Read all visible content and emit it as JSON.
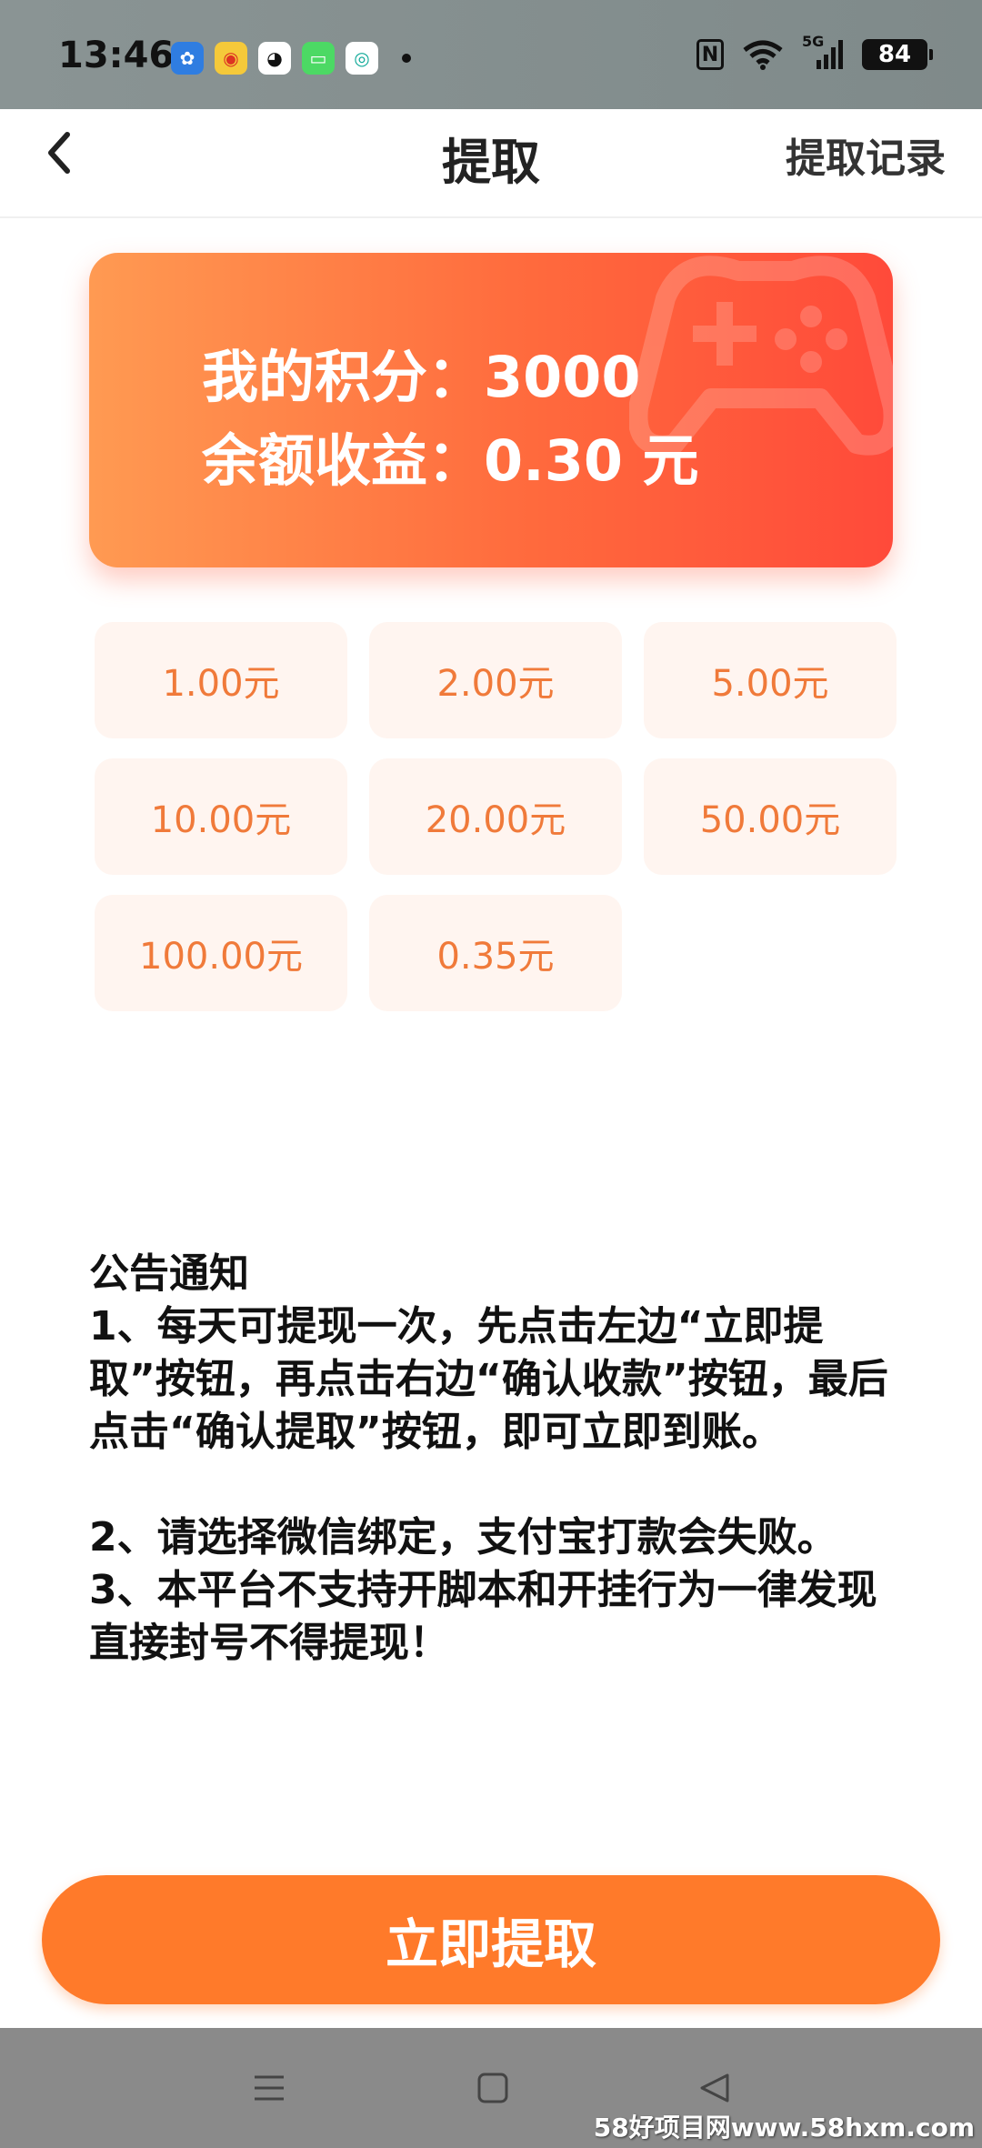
{
  "status_bar": {
    "time": "13:46",
    "network": "5G",
    "battery": "84",
    "nfc": "N"
  },
  "header": {
    "back_icon": "chevron-left-icon",
    "title": "提取",
    "records_label": "提取记录"
  },
  "balance_card": {
    "points_line": "我的积分：3000",
    "balance_line": "余额收益：0.30 元"
  },
  "amount_options": [
    "1.00元",
    "2.00元",
    "5.00元",
    "10.00元",
    "20.00元",
    "50.00元",
    "100.00元",
    "0.35元"
  ],
  "notice": {
    "title": "公告通知",
    "item1": "1、每天可提现一次，先点击左边“立即提取”按钮，再点击右边“确认收款”按钮，最后点击“确认提取”按钮，即可立即到账。",
    "item2": "2、请选择微信绑定，支付宝打款会失败。",
    "item3": "3、本平台不支持开脚本和开挂行为一律发现直接封号不得提现！"
  },
  "withdraw_button": "立即提取",
  "watermark": "58好项目网www.58hxm.com",
  "colors": {
    "accent": "#ff7a2a",
    "option_text": "#f07a3a",
    "option_bg": "#fff5f0"
  }
}
